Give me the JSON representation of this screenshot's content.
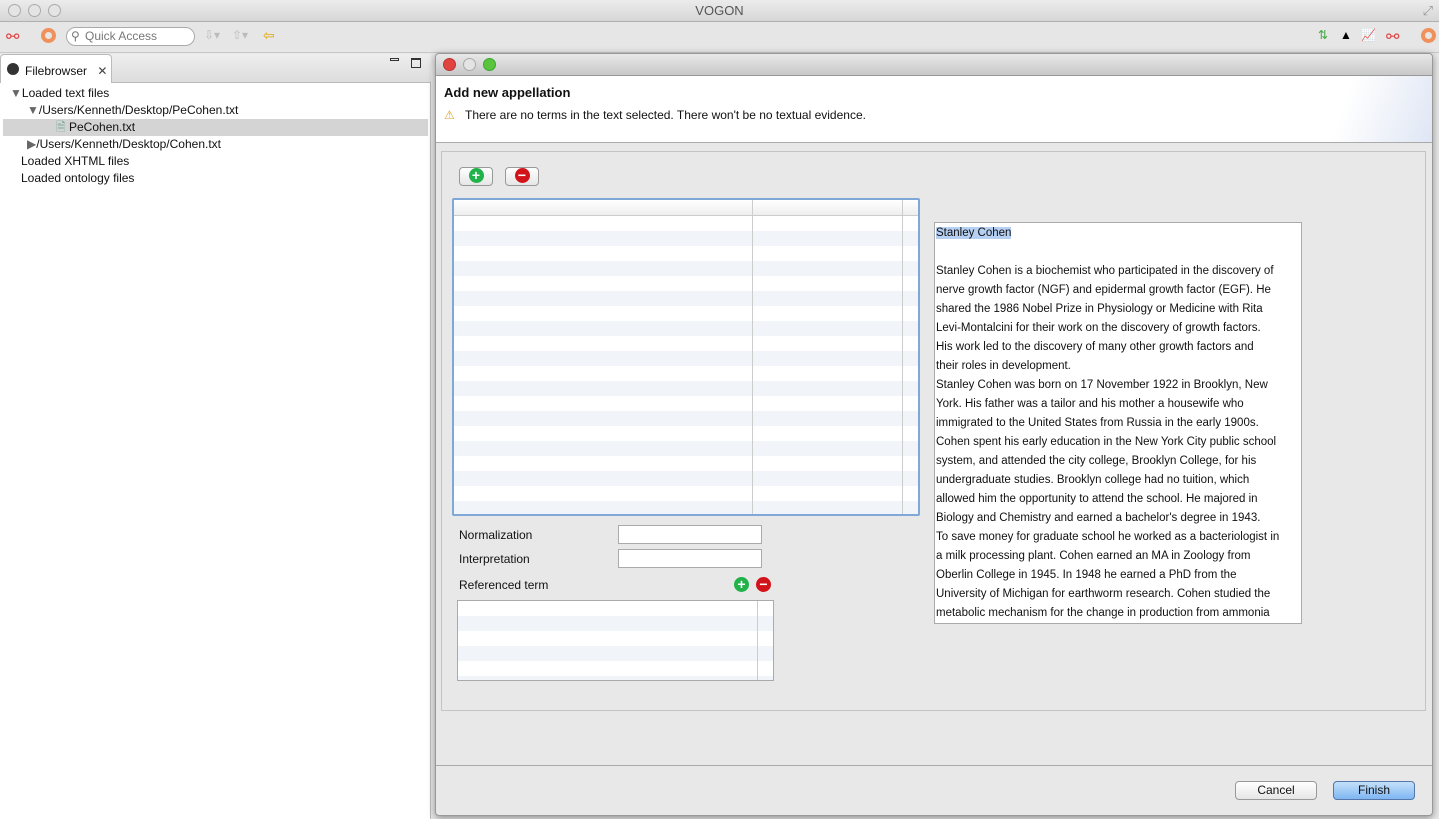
{
  "app": {
    "title": "VOGON"
  },
  "toolbar": {
    "quick_access_placeholder": "Quick Access",
    "icons": [
      "graph-perspective-icon",
      "stop-icon",
      "search-icon",
      "next-annotation-icon",
      "previous-annotation-icon",
      "last-edit-icon",
      "tree-layout-icon",
      "pyramid-icon",
      "chart-icon",
      "graph-icon",
      "stop-icon"
    ]
  },
  "filebrowser": {
    "tab_label": "Filebrowser",
    "tree": [
      {
        "label": "Loaded text files",
        "expanded": true,
        "level": 0
      },
      {
        "label": "/Users/Kenneth/Desktop/PeCohen.txt",
        "expanded": true,
        "level": 1
      },
      {
        "label": "PeCohen.txt",
        "level": 2,
        "selected": true
      },
      {
        "label": "/Users/Kenneth/Desktop/Cohen.txt",
        "expanded": false,
        "level": 1
      },
      {
        "label": "Loaded XHTML files",
        "level": 0
      },
      {
        "label": "Loaded ontology files",
        "level": 0
      }
    ]
  },
  "dialog": {
    "title": "Add new appellation",
    "warning": "There are no terms in the text selected. There won't be no textual evidence.",
    "normalization_label": "Normalization",
    "normalization_value": "",
    "interpretation_label": "Interpretation",
    "interpretation_value": "",
    "referenced_term_label": "Referenced term",
    "text_title": "Stanley Cohen",
    "text_lines": [
      "",
      "Stanley Cohen is a biochemist who participated in the discovery of",
      "nerve growth factor (NGF) and epidermal growth factor (EGF).  He",
      "shared the 1986 Nobel Prize in Physiology or Medicine with Rita",
      "Levi-Montalcini for their work on the discovery of growth factors.",
      "His work led to the discovery of many other growth factors and",
      "their roles in development.",
      "Stanley Cohen was born on 17 November 1922 in Brooklyn, New",
      "York.  His father was a tailor and his mother a housewife who",
      "immigrated to the United States from Russia in the early 1900s.",
      "Cohen spent his early education in the New York City public school",
      "system, and attended the city college, Brooklyn College, for his",
      "undergraduate studies.  Brooklyn college had no tuition, which",
      "allowed him the opportunity to attend the school.   He majored in",
      "Biology and Chemistry and earned a bachelor's degree in 1943.",
      "To save money for graduate school he worked as a bacteriologist in",
      "a milk processing plant.  Cohen earned an MA in Zoology from",
      "Oberlin College in 1945.  In 1948 he earned a PhD from the",
      "University of Michigan for earthworm research.  Cohen studied the",
      "metabolic mechanism for the change in production from ammonia"
    ],
    "cancel_label": "Cancel",
    "finish_label": "Finish"
  },
  "colors": {
    "add": "#22b24a",
    "remove": "#d2141a",
    "selection": "#b5d0f2",
    "focus": "#7fa7d8",
    "default_button": "#7fb6f2"
  }
}
